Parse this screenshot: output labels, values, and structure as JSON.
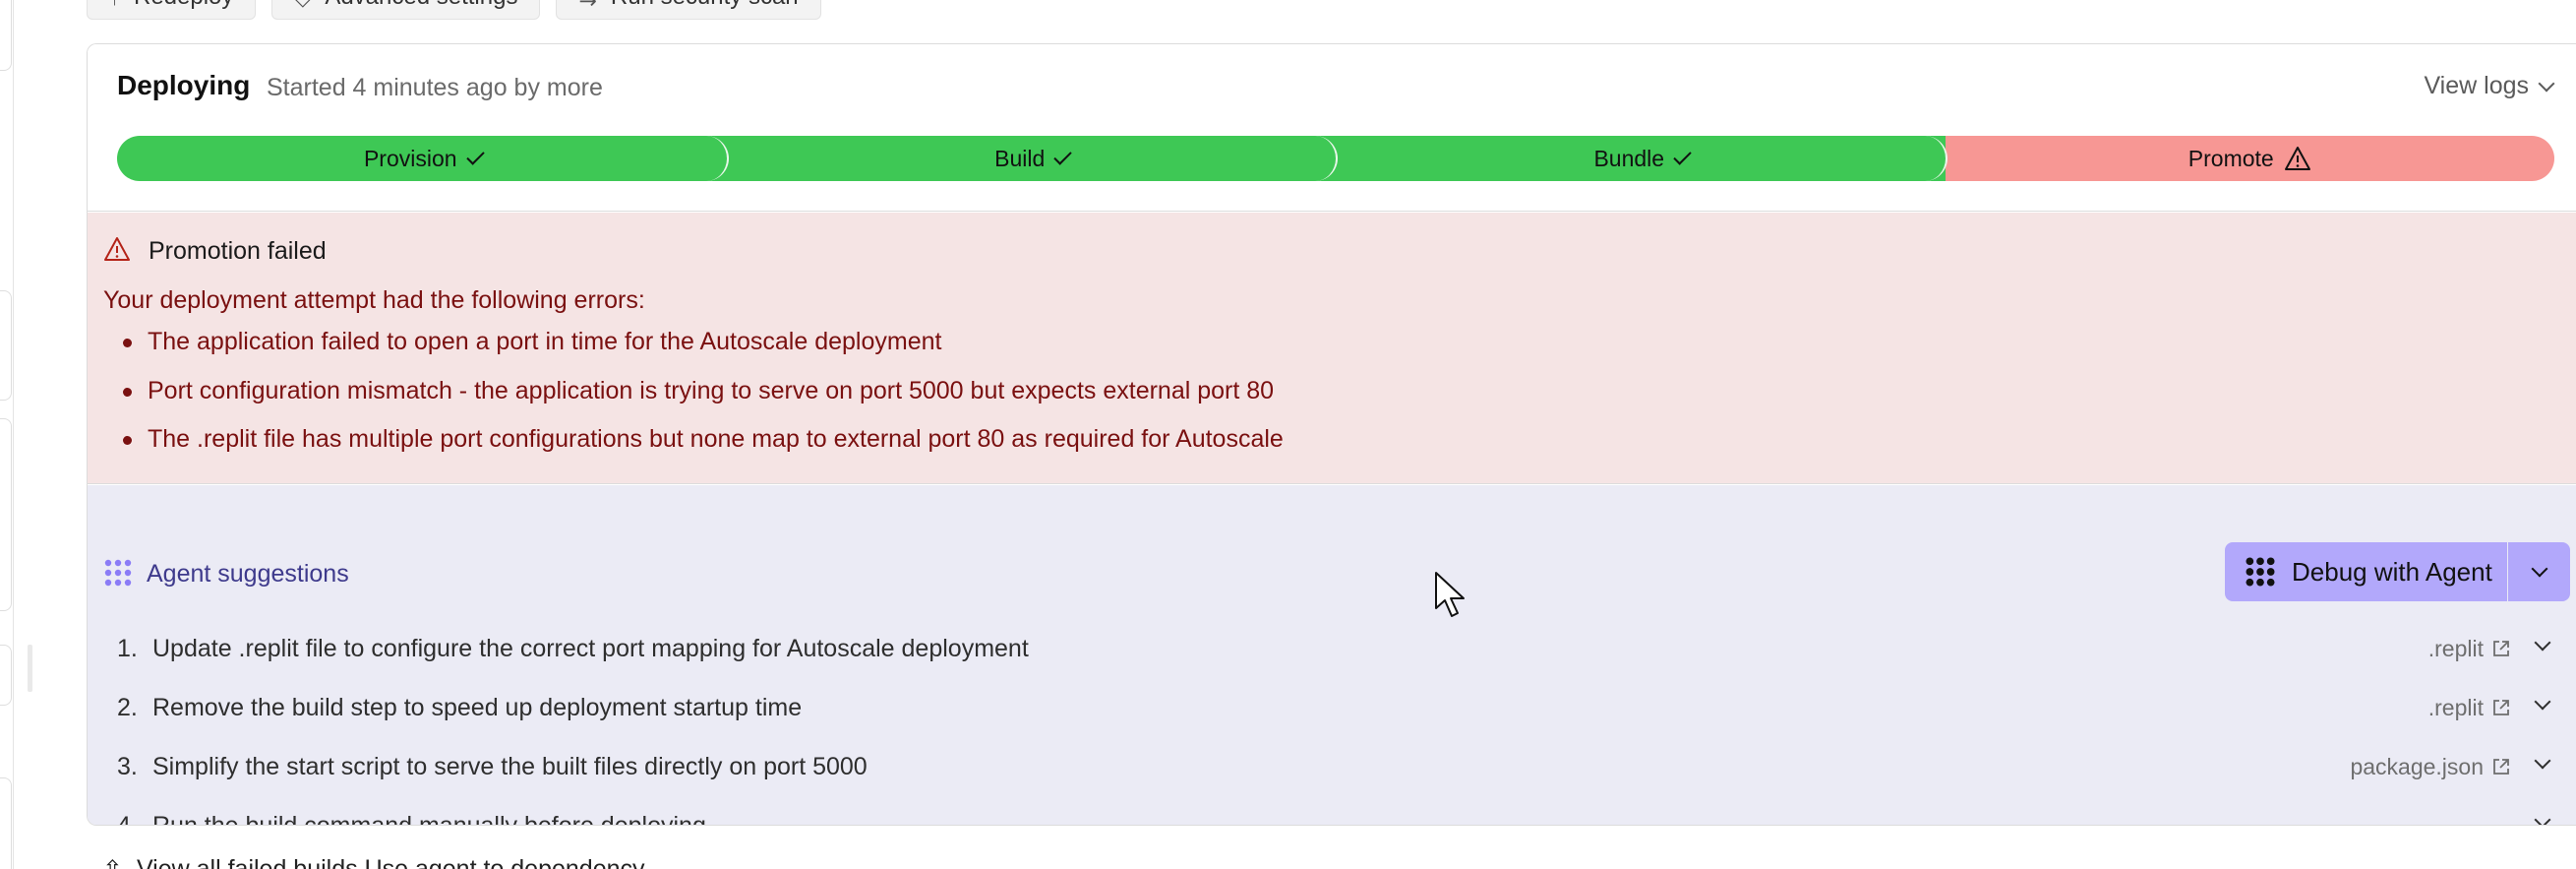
{
  "toolbar": {
    "redeploy_label": "Redeploy",
    "advanced_label": "Advanced settings",
    "scan_label": "Run security scan"
  },
  "deployment": {
    "status": "Deploying",
    "started": "Started 4 minutes ago by more",
    "view_logs": "View logs",
    "stages": [
      {
        "label": "Provision",
        "state": "success"
      },
      {
        "label": "Build",
        "state": "success"
      },
      {
        "label": "Bundle",
        "state": "success"
      },
      {
        "label": "Promote",
        "state": "failed"
      }
    ]
  },
  "error": {
    "title": "Promotion failed",
    "intro": "Your deployment attempt had the following errors:",
    "items": [
      "The application failed to open a port in time for the Autoscale deployment",
      "Port configuration mismatch - the application is trying to serve on port 5000 but expects external port 80",
      "The .replit file has multiple port configurations but none map to external port 80 as required for Autoscale"
    ]
  },
  "suggestions": {
    "title": "Agent suggestions",
    "debug_button": "Debug with Agent",
    "items": [
      {
        "num": "1.",
        "text": "Update .replit file to configure the correct port mapping for Autoscale deployment",
        "file": ".replit"
      },
      {
        "num": "2.",
        "text": "Remove the build step to speed up deployment startup time",
        "file": ".replit"
      },
      {
        "num": "3.",
        "text": "Simplify the start script to serve the built files directly on port 5000",
        "file": "package.json"
      },
      {
        "num": "4.",
        "text": "Run the build command manually before deploying",
        "file": ""
      }
    ]
  },
  "footer": {
    "cut_text": "View all failed builds  Use agent to dependency"
  },
  "colors": {
    "success": "#3ec855",
    "failed": "#f79794",
    "error_bg": "#f5e4e4",
    "error_text": "#7a1010",
    "agent_bg": "#ebebf5",
    "agent_button": "#b2a8fb",
    "agent_text": "#3e3a8c"
  }
}
